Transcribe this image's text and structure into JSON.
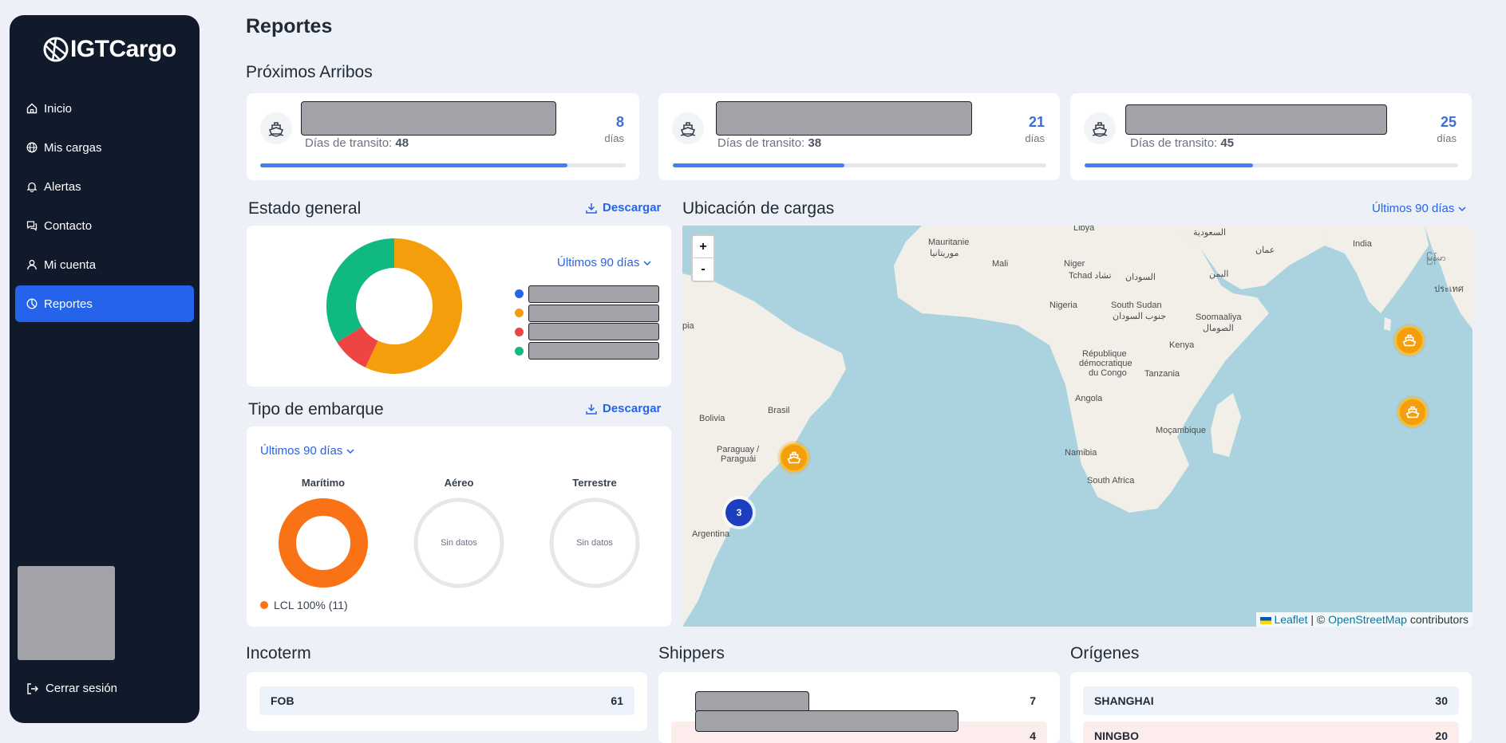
{
  "brand": {
    "name": "IGTCargo"
  },
  "sidebar": {
    "items": [
      {
        "label": "Inicio",
        "icon": "home-icon"
      },
      {
        "label": "Mis cargas",
        "icon": "globe-icon"
      },
      {
        "label": "Alertas",
        "icon": "bell-icon"
      },
      {
        "label": "Contacto",
        "icon": "chat-icon"
      },
      {
        "label": "Mi cuenta",
        "icon": "user-icon"
      },
      {
        "label": "Reportes",
        "icon": "chart-pie-icon",
        "active": true
      }
    ],
    "logout_label": "Cerrar sesión"
  },
  "page": {
    "title": "Reportes"
  },
  "arrivals": {
    "title": "Próximos Arribos",
    "transit_label": "Días de transito:",
    "unit": "días",
    "items": [
      {
        "transit_days": "48",
        "days_left": "8",
        "progress": 0.84
      },
      {
        "transit_days": "38",
        "days_left": "21",
        "progress": 0.46
      },
      {
        "transit_days": "45",
        "days_left": "25",
        "progress": 0.45
      }
    ]
  },
  "estado": {
    "title": "Estado general",
    "download_label": "Descargar",
    "period": "Últimos 90 días",
    "colors": [
      "#2563eb",
      "#f59e0b",
      "#ef4444",
      "#10b981"
    ]
  },
  "chart_data": {
    "type": "pie",
    "categories": [
      "",
      "",
      "",
      ""
    ],
    "values": [
      0,
      57,
      9,
      34
    ],
    "colors": [
      "#2563eb",
      "#f59e0b",
      "#ef4444",
      "#10b981"
    ]
  },
  "tipo": {
    "title": "Tipo de embarque",
    "download_label": "Descargar",
    "period": "Últimos 90 días",
    "modes": [
      {
        "label": "Marítimo",
        "has_data": true,
        "color": "#f97316"
      },
      {
        "label": "Aéreo",
        "has_data": false,
        "nodata": "Sin datos"
      },
      {
        "label": "Terrestre",
        "has_data": false,
        "nodata": "Sin datos"
      }
    ],
    "legend": "LCL 100% (11)",
    "legend_color": "#f97316"
  },
  "map": {
    "title": "Ubicación de cargas",
    "period": "Últimos 90 días",
    "zoom_in": "+",
    "zoom_out": "-",
    "cluster_count": "3",
    "labels": [
      "Libya",
      "السعودية",
      "Mauritanie",
      "موريتانيا",
      "Mali",
      "Niger",
      "Tchad تشاد",
      "السودان",
      "اليمن",
      "عمان",
      "India",
      "မြန်မာ",
      "ประเทศ",
      "Nigeria",
      "South Sudan",
      "جنوب السودان",
      "Soomaaliya",
      "الصومال",
      "Kenya",
      "République",
      "démocratique",
      "du Congo",
      "Tanzania",
      "Angola",
      "Moçambique",
      "Namibia",
      "South Africa",
      "Brasil",
      "Bolivia",
      "Paraguay /",
      "Paraguái",
      "Argentina",
      "pia"
    ],
    "attribution": {
      "leaflet": "Leaflet",
      "sep": " | © ",
      "osm": "OpenStreetMap",
      "rest": " contributors"
    }
  },
  "incoterm": {
    "title": "Incoterm",
    "rows": [
      {
        "name": "FOB",
        "value": "61"
      }
    ]
  },
  "shippers": {
    "title": "Shippers",
    "rows": [
      {
        "value": "7"
      },
      {
        "value": "4"
      }
    ]
  },
  "origenes": {
    "title": "Orígenes",
    "rows": [
      {
        "name": "SHANGHAI",
        "value": "30"
      },
      {
        "name": "NINGBO",
        "value": "20"
      }
    ]
  }
}
